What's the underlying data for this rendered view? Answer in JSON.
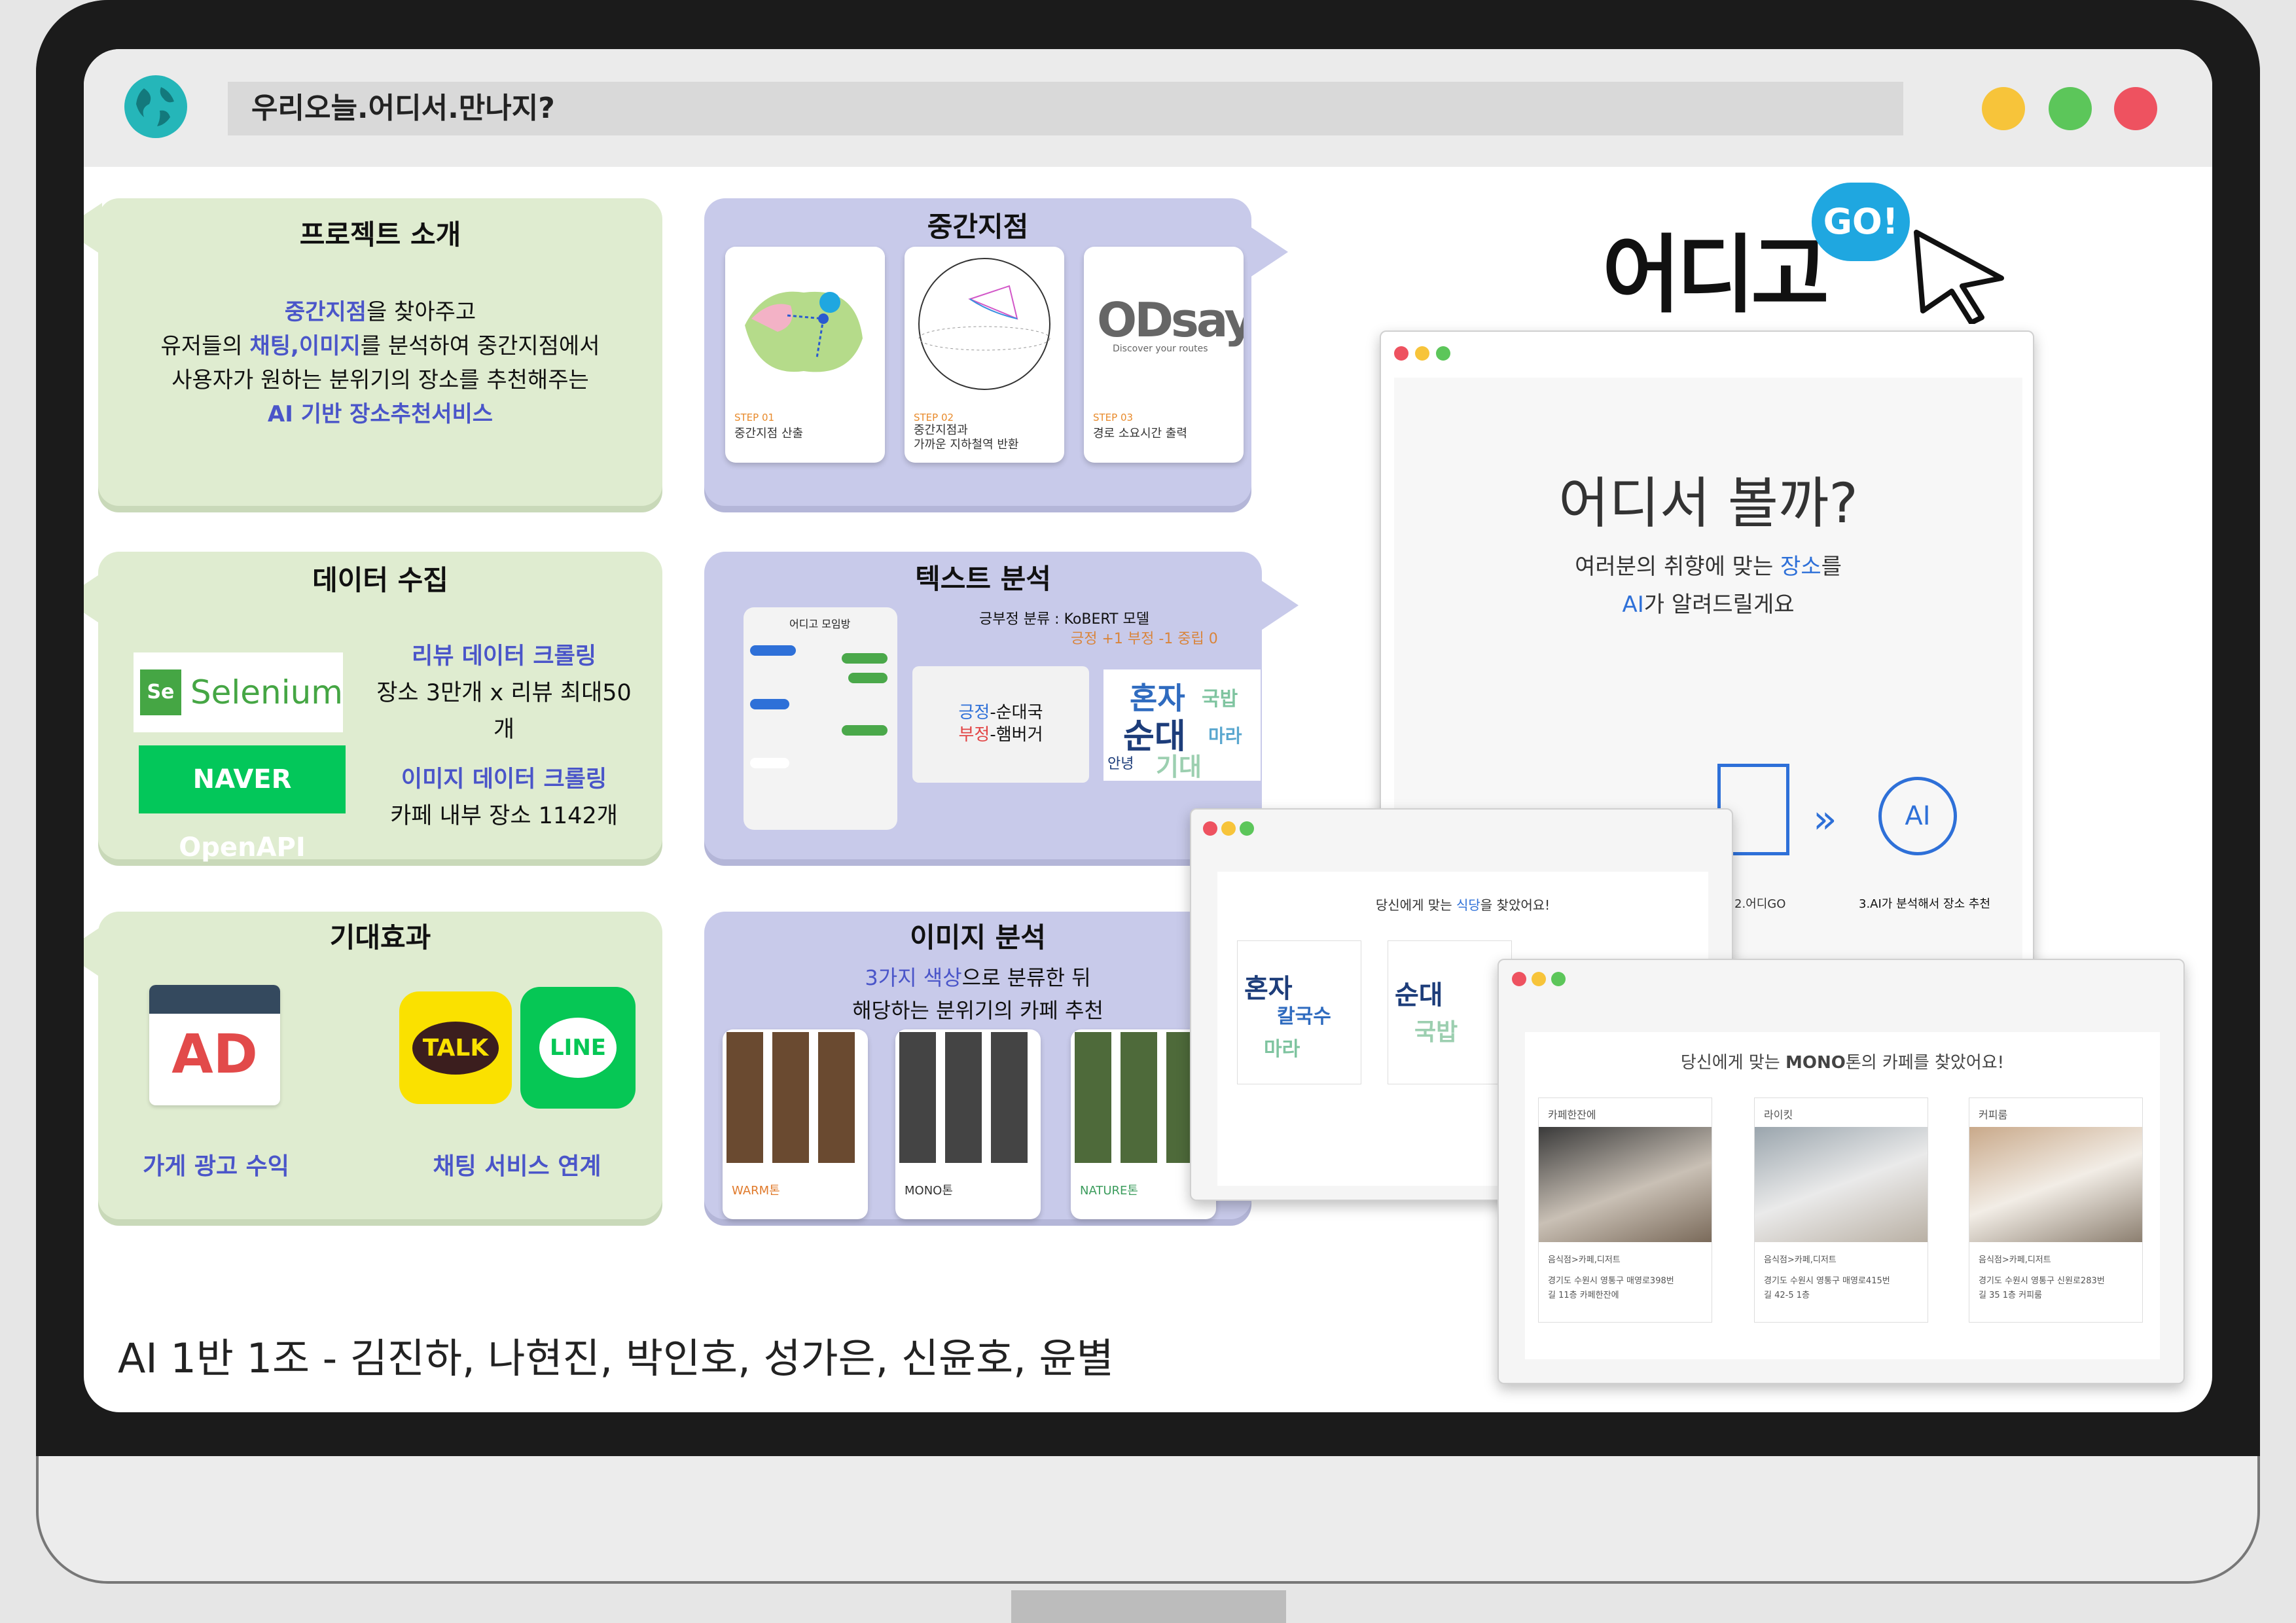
{
  "window": {
    "title": "우리오늘.어디서.만나지?"
  },
  "colors": {
    "green": "#dfecd0",
    "purple": "#c8caea",
    "accent": "#4a55c9",
    "red": "#ee5260",
    "yellow": "#f7c43a",
    "greenDot": "#5cc65a"
  },
  "project": {
    "title": "프로젝트 소개",
    "l1a": "중간지점",
    "l1b": "을 찾아주고",
    "l2a": "유저들의 ",
    "l2b": "채팅,이미지",
    "l2c": "를 분석하여 중간지점에서",
    "l3": "사용자가 원하는 분위기의 장소를 추천해주는",
    "l4": "AI 기반 장소추천서비스"
  },
  "midpoint": {
    "title": "중간지점",
    "steps": [
      {
        "step": "STEP 01",
        "label": "중간지점 산출"
      },
      {
        "step": "STEP 02",
        "label": "중간지점과",
        "label2": "가까운 지하철역 반환"
      },
      {
        "step": "STEP 03",
        "label": "경로 소요시간 출력"
      }
    ],
    "odsay": "ODsay",
    "odsay_sub": "Discover your routes"
  },
  "data_collect": {
    "title": "데이터 수집",
    "selenium": "Selenium",
    "naver": "NAVER OpenAPI",
    "r1": "리뷰 데이터 크롤링",
    "r2": "장소 3만개 x 리뷰 최대50개",
    "r3": "이미지 데이터 크롤링",
    "r4": "카페 내부 장소 1142개"
  },
  "text_analysis": {
    "title": "텍스트 분석",
    "model": "긍부정 분류 : KoBERT 모델",
    "legend": "긍정 +1 부정 -1 중립 0",
    "chat_title": "어디고 모임방",
    "pos": "긍정",
    "pos_item": "-순대국",
    "neg": "부정",
    "neg_item": "-햄버거",
    "words": [
      "혼자",
      "순대",
      "국밥",
      "기대",
      "마라",
      "안녕"
    ]
  },
  "effect": {
    "title": "기대효과",
    "ad": "AD",
    "ad_label": "가게 광고 수익",
    "talk": "TALK",
    "line": "LINE",
    "chat_label": "채팅 서비스 연계"
  },
  "image_analysis": {
    "title": "이미지 분석",
    "l1a": "3가지 색상",
    "l1b": "으로 분류한 뒤",
    "l2": "해당하는 분위기의 카페 추천",
    "cats": [
      "WARM톤",
      "MONO톤",
      "NATURE톤"
    ]
  },
  "brand": {
    "name": "어디고",
    "go": "GO!"
  },
  "app": {
    "heading": "어디서 볼까?",
    "sub1a": "여러분의 취향에 맞는 ",
    "sub1b": "장소",
    "sub1c": "를",
    "sub2a": "AI",
    "sub2b": "가 알려드릴게요",
    "step2": "2.어디GO",
    "step3": "3.AI가 분석해서 장소 추천"
  },
  "mock1": {
    "title_a": "당신에게 맞는 ",
    "title_b": "식당",
    "title_c": "을 찾았어요!",
    "words": [
      "혼자",
      "칼국수",
      "마라",
      "순대",
      "국밥"
    ]
  },
  "mock2": {
    "title_a": "당신에게 맞는 ",
    "title_b": "MONO",
    "title_c": "톤의 카페를 찾았어요!",
    "cafes": [
      {
        "name": "카페한잔에",
        "cat": "음식점>카페,디저트",
        "addr1": "경기도 수원시 영통구 매영로398번",
        "addr2": "길 11층 카페한잔에"
      },
      {
        "name": "라이킷",
        "cat": "음식점>카페,디저트",
        "addr1": "경기도 수원시 영통구 매영로415번",
        "addr2": "길 42-5 1층"
      },
      {
        "name": "커피룸",
        "cat": "음식점>카페,디저트",
        "addr1": "경기도 수원시 영통구 신원로283번",
        "addr2": "길 35 1층 커피룸"
      }
    ]
  },
  "footer": {
    "team": "AI 1반 1조 - 김진하, 나현진, 박인호, 성가은, 신윤호, 윤별"
  }
}
